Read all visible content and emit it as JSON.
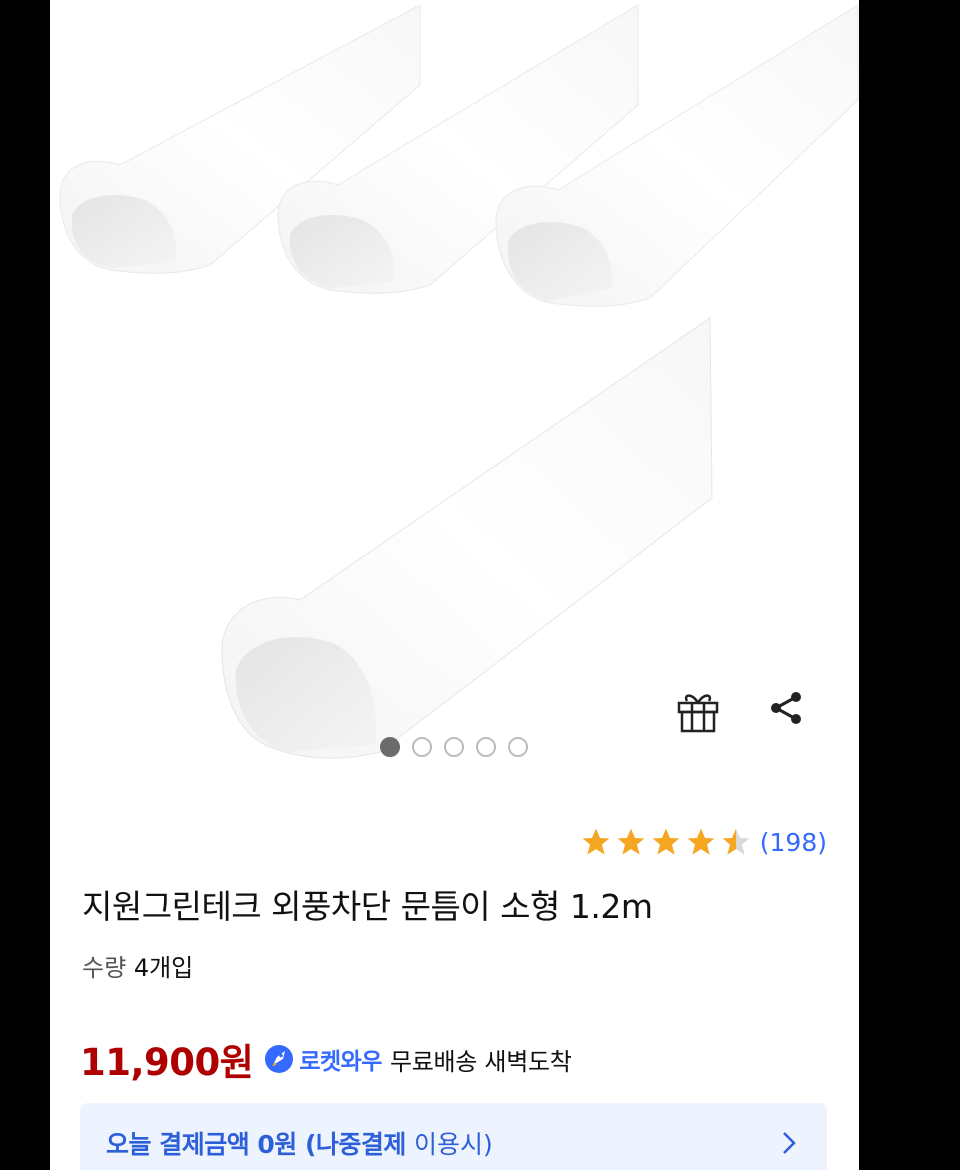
{
  "gallery": {
    "image_alt": "외풍차단 문틈이 product photo",
    "dots_total": 5,
    "dots_active": 1
  },
  "actions": {
    "gift_icon": "gift-icon",
    "share_icon": "share-icon"
  },
  "rating": {
    "stars": 4.5,
    "count": "(198)"
  },
  "product": {
    "title": "지원그린테크 외풍차단 문틈이 소형 1.2m",
    "qty_label": "수량",
    "qty_value": "4개입"
  },
  "price": {
    "amount": "11,900원",
    "rocket_label": "로켓와우",
    "shipping": "무료배송 새벽도착"
  },
  "pay_banner": {
    "strong": "오늘 결제금액 0원 (나중결제",
    "light": "이용시)"
  },
  "colors": {
    "price": "#ae0000",
    "accent": "#346aff",
    "star": "#f5a623",
    "banner_bg": "#edf3ff"
  }
}
